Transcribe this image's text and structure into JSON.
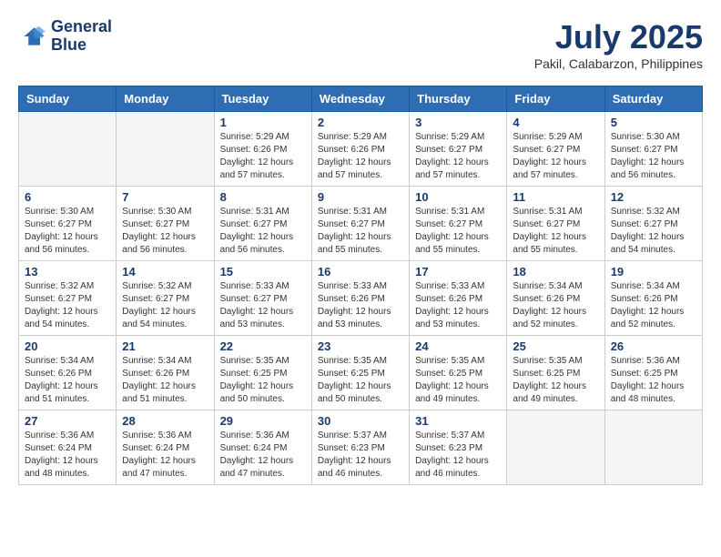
{
  "header": {
    "logo_line1": "General",
    "logo_line2": "Blue",
    "month_year": "July 2025",
    "location": "Pakil, Calabarzon, Philippines"
  },
  "days_of_week": [
    "Sunday",
    "Monday",
    "Tuesday",
    "Wednesday",
    "Thursday",
    "Friday",
    "Saturday"
  ],
  "weeks": [
    [
      {
        "day": "",
        "empty": true
      },
      {
        "day": "",
        "empty": true
      },
      {
        "day": "1",
        "sunrise": "Sunrise: 5:29 AM",
        "sunset": "Sunset: 6:26 PM",
        "daylight": "Daylight: 12 hours and 57 minutes."
      },
      {
        "day": "2",
        "sunrise": "Sunrise: 5:29 AM",
        "sunset": "Sunset: 6:26 PM",
        "daylight": "Daylight: 12 hours and 57 minutes."
      },
      {
        "day": "3",
        "sunrise": "Sunrise: 5:29 AM",
        "sunset": "Sunset: 6:27 PM",
        "daylight": "Daylight: 12 hours and 57 minutes."
      },
      {
        "day": "4",
        "sunrise": "Sunrise: 5:29 AM",
        "sunset": "Sunset: 6:27 PM",
        "daylight": "Daylight: 12 hours and 57 minutes."
      },
      {
        "day": "5",
        "sunrise": "Sunrise: 5:30 AM",
        "sunset": "Sunset: 6:27 PM",
        "daylight": "Daylight: 12 hours and 56 minutes."
      }
    ],
    [
      {
        "day": "6",
        "sunrise": "Sunrise: 5:30 AM",
        "sunset": "Sunset: 6:27 PM",
        "daylight": "Daylight: 12 hours and 56 minutes."
      },
      {
        "day": "7",
        "sunrise": "Sunrise: 5:30 AM",
        "sunset": "Sunset: 6:27 PM",
        "daylight": "Daylight: 12 hours and 56 minutes."
      },
      {
        "day": "8",
        "sunrise": "Sunrise: 5:31 AM",
        "sunset": "Sunset: 6:27 PM",
        "daylight": "Daylight: 12 hours and 56 minutes."
      },
      {
        "day": "9",
        "sunrise": "Sunrise: 5:31 AM",
        "sunset": "Sunset: 6:27 PM",
        "daylight": "Daylight: 12 hours and 55 minutes."
      },
      {
        "day": "10",
        "sunrise": "Sunrise: 5:31 AM",
        "sunset": "Sunset: 6:27 PM",
        "daylight": "Daylight: 12 hours and 55 minutes."
      },
      {
        "day": "11",
        "sunrise": "Sunrise: 5:31 AM",
        "sunset": "Sunset: 6:27 PM",
        "daylight": "Daylight: 12 hours and 55 minutes."
      },
      {
        "day": "12",
        "sunrise": "Sunrise: 5:32 AM",
        "sunset": "Sunset: 6:27 PM",
        "daylight": "Daylight: 12 hours and 54 minutes."
      }
    ],
    [
      {
        "day": "13",
        "sunrise": "Sunrise: 5:32 AM",
        "sunset": "Sunset: 6:27 PM",
        "daylight": "Daylight: 12 hours and 54 minutes."
      },
      {
        "day": "14",
        "sunrise": "Sunrise: 5:32 AM",
        "sunset": "Sunset: 6:27 PM",
        "daylight": "Daylight: 12 hours and 54 minutes."
      },
      {
        "day": "15",
        "sunrise": "Sunrise: 5:33 AM",
        "sunset": "Sunset: 6:27 PM",
        "daylight": "Daylight: 12 hours and 53 minutes."
      },
      {
        "day": "16",
        "sunrise": "Sunrise: 5:33 AM",
        "sunset": "Sunset: 6:26 PM",
        "daylight": "Daylight: 12 hours and 53 minutes."
      },
      {
        "day": "17",
        "sunrise": "Sunrise: 5:33 AM",
        "sunset": "Sunset: 6:26 PM",
        "daylight": "Daylight: 12 hours and 53 minutes."
      },
      {
        "day": "18",
        "sunrise": "Sunrise: 5:34 AM",
        "sunset": "Sunset: 6:26 PM",
        "daylight": "Daylight: 12 hours and 52 minutes."
      },
      {
        "day": "19",
        "sunrise": "Sunrise: 5:34 AM",
        "sunset": "Sunset: 6:26 PM",
        "daylight": "Daylight: 12 hours and 52 minutes."
      }
    ],
    [
      {
        "day": "20",
        "sunrise": "Sunrise: 5:34 AM",
        "sunset": "Sunset: 6:26 PM",
        "daylight": "Daylight: 12 hours and 51 minutes."
      },
      {
        "day": "21",
        "sunrise": "Sunrise: 5:34 AM",
        "sunset": "Sunset: 6:26 PM",
        "daylight": "Daylight: 12 hours and 51 minutes."
      },
      {
        "day": "22",
        "sunrise": "Sunrise: 5:35 AM",
        "sunset": "Sunset: 6:25 PM",
        "daylight": "Daylight: 12 hours and 50 minutes."
      },
      {
        "day": "23",
        "sunrise": "Sunrise: 5:35 AM",
        "sunset": "Sunset: 6:25 PM",
        "daylight": "Daylight: 12 hours and 50 minutes."
      },
      {
        "day": "24",
        "sunrise": "Sunrise: 5:35 AM",
        "sunset": "Sunset: 6:25 PM",
        "daylight": "Daylight: 12 hours and 49 minutes."
      },
      {
        "day": "25",
        "sunrise": "Sunrise: 5:35 AM",
        "sunset": "Sunset: 6:25 PM",
        "daylight": "Daylight: 12 hours and 49 minutes."
      },
      {
        "day": "26",
        "sunrise": "Sunrise: 5:36 AM",
        "sunset": "Sunset: 6:25 PM",
        "daylight": "Daylight: 12 hours and 48 minutes."
      }
    ],
    [
      {
        "day": "27",
        "sunrise": "Sunrise: 5:36 AM",
        "sunset": "Sunset: 6:24 PM",
        "daylight": "Daylight: 12 hours and 48 minutes."
      },
      {
        "day": "28",
        "sunrise": "Sunrise: 5:36 AM",
        "sunset": "Sunset: 6:24 PM",
        "daylight": "Daylight: 12 hours and 47 minutes."
      },
      {
        "day": "29",
        "sunrise": "Sunrise: 5:36 AM",
        "sunset": "Sunset: 6:24 PM",
        "daylight": "Daylight: 12 hours and 47 minutes."
      },
      {
        "day": "30",
        "sunrise": "Sunrise: 5:37 AM",
        "sunset": "Sunset: 6:23 PM",
        "daylight": "Daylight: 12 hours and 46 minutes."
      },
      {
        "day": "31",
        "sunrise": "Sunrise: 5:37 AM",
        "sunset": "Sunset: 6:23 PM",
        "daylight": "Daylight: 12 hours and 46 minutes."
      },
      {
        "day": "",
        "empty": true
      },
      {
        "day": "",
        "empty": true
      }
    ]
  ]
}
